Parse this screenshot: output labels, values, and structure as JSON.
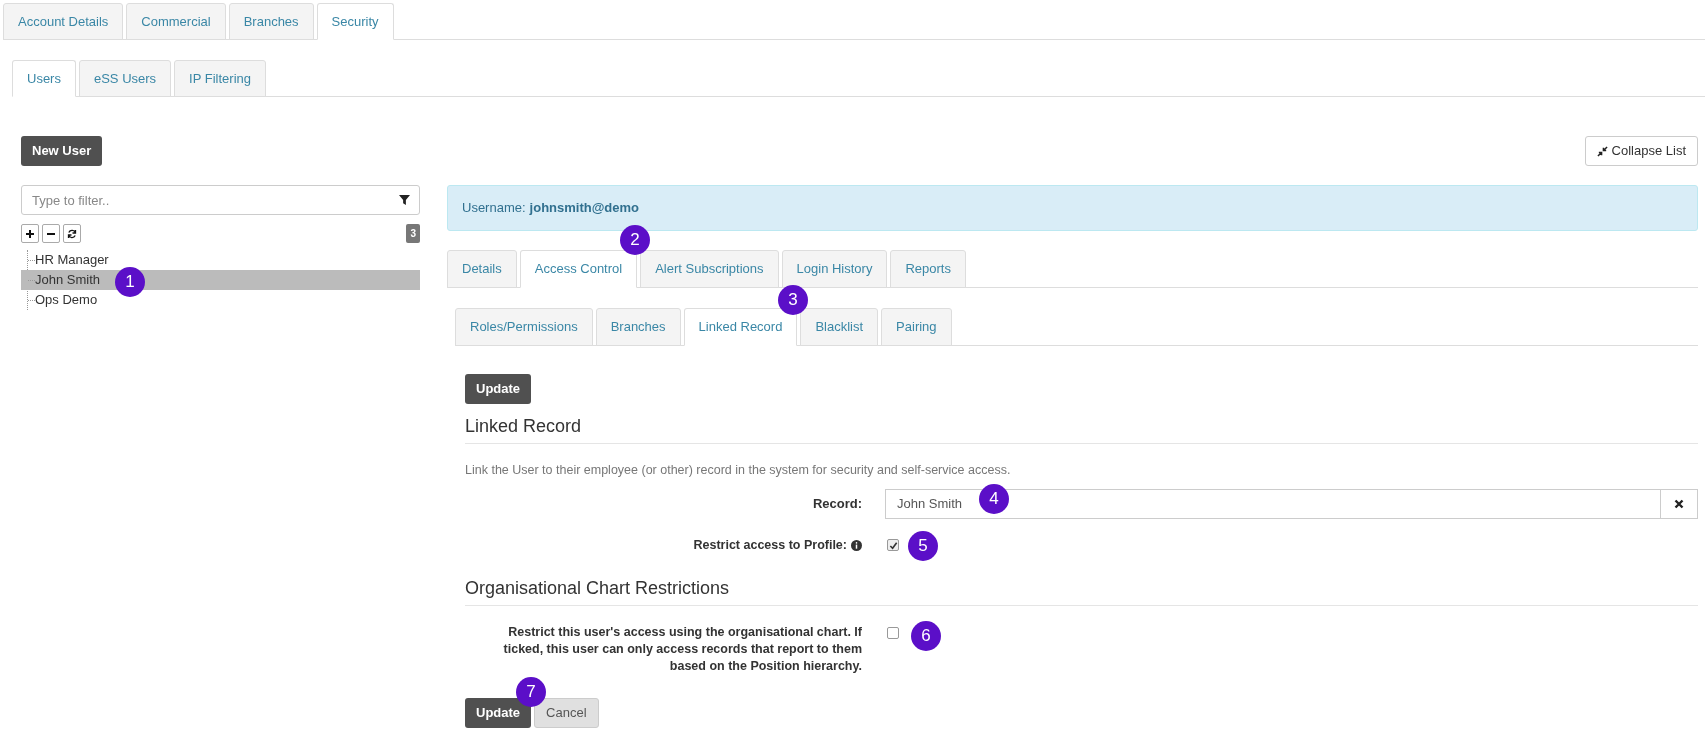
{
  "top_tabs": [
    {
      "label": "Account Details",
      "selected": false
    },
    {
      "label": "Commercial",
      "selected": false
    },
    {
      "label": "Branches",
      "selected": false
    },
    {
      "label": "Security",
      "selected": true
    }
  ],
  "section_tabs": [
    {
      "label": "Users",
      "selected": true
    },
    {
      "label": "eSS Users",
      "selected": false
    },
    {
      "label": "IP Filtering",
      "selected": false
    }
  ],
  "new_user_button": "New User",
  "collapse_button": "Collapse List",
  "filter": {
    "placeholder": "Type to filter.."
  },
  "tree": {
    "count": "3",
    "items": [
      {
        "label": "HR Manager",
        "selected": false
      },
      {
        "label": "John Smith",
        "selected": true
      },
      {
        "label": "Ops Demo",
        "selected": false
      }
    ]
  },
  "user_banner": {
    "label": "Username:",
    "value": "johnsmith@demo"
  },
  "user_tabs": [
    {
      "label": "Details",
      "selected": false
    },
    {
      "label": "Access Control",
      "selected": true
    },
    {
      "label": "Alert Subscriptions",
      "selected": false
    },
    {
      "label": "Login History",
      "selected": false
    },
    {
      "label": "Reports",
      "selected": false
    }
  ],
  "access_tabs": [
    {
      "label": "Roles/Permissions",
      "selected": false
    },
    {
      "label": "Branches",
      "selected": false
    },
    {
      "label": "Linked Record",
      "selected": true
    },
    {
      "label": "Blacklist",
      "selected": false
    },
    {
      "label": "Pairing",
      "selected": false
    }
  ],
  "update_button": "Update",
  "linked_record": {
    "heading": "Linked Record",
    "description": "Link the User to their employee (or other) record in the system for security and self-service access.",
    "record_label": "Record:",
    "record_value": "John Smith",
    "restrict_label": "Restrict access to Profile:",
    "restrict_checked": true
  },
  "org_chart": {
    "heading": "Organisational Chart Restrictions",
    "label": "Restrict this user's access using the organisational chart. If ticked, this user can only access records that report to them based on the Position hierarchy.",
    "checked": false
  },
  "footer_buttons": [
    "Update",
    "Cancel"
  ],
  "callouts": [
    "1",
    "2",
    "3",
    "4",
    "5",
    "6",
    "7"
  ]
}
